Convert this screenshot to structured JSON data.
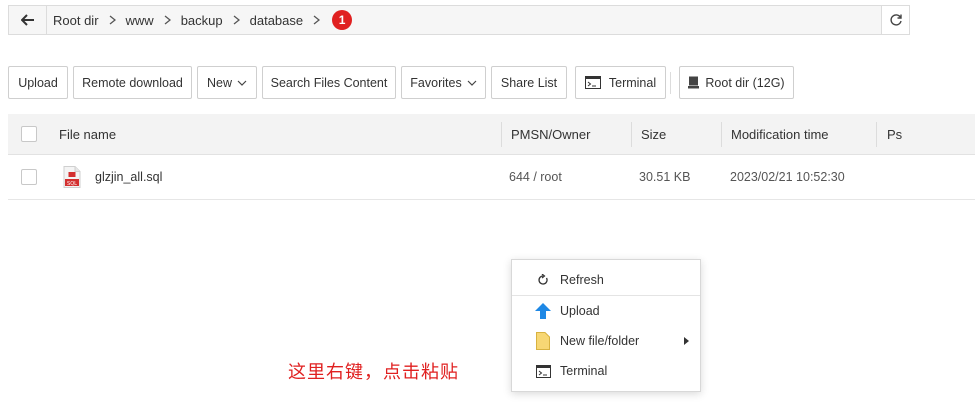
{
  "path": {
    "crumbs": [
      "Root dir",
      "www",
      "backup",
      "database"
    ],
    "step_badge": "1"
  },
  "toolbar": {
    "upload": "Upload",
    "remote_download": "Remote download",
    "new": "New",
    "search_files": "Search Files Content",
    "favorites": "Favorites",
    "share_list": "Share List",
    "terminal": "Terminal",
    "root_dir": "Root dir (12G)"
  },
  "table": {
    "columns": [
      "File name",
      "PMSN/Owner",
      "Size",
      "Modification time",
      "Ps"
    ],
    "rows": [
      {
        "name": "glzjin_all.sql",
        "icon_label": "SQL",
        "perm": "644 / root",
        "size": "30.51 KB",
        "mtime": "2023/02/21 10:52:30",
        "ps": ""
      }
    ]
  },
  "context_menu": {
    "items": [
      "Refresh",
      "Upload",
      "New file/folder",
      "Terminal"
    ]
  },
  "annotation": "这里右键，点击粘贴",
  "colors": {
    "accent_red": "#e02020",
    "upload_blue": "#1e88e5",
    "folder_yellow": "#f7d774"
  }
}
